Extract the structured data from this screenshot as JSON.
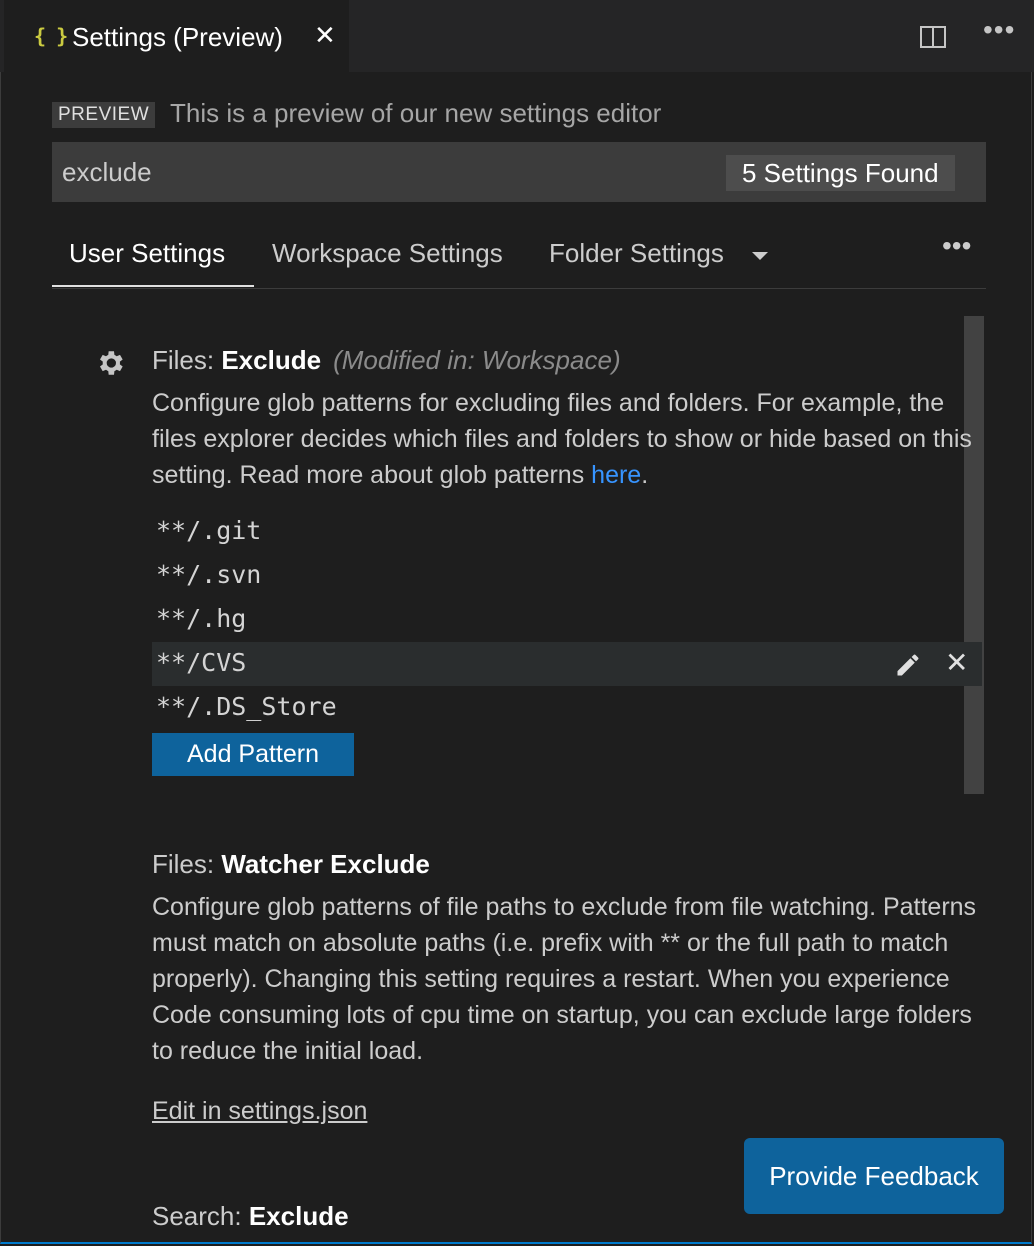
{
  "tab": {
    "icon": "{ }",
    "title": "Settings (Preview)",
    "close": "✕",
    "more": "•••"
  },
  "preview": {
    "badge": "PREVIEW",
    "text": "This is a preview of our new settings editor"
  },
  "search": {
    "value": "exclude",
    "count": "5 Settings Found"
  },
  "scopes": {
    "items": [
      "User Settings",
      "Workspace Settings",
      "Folder Settings"
    ],
    "active": "User Settings",
    "more": "•••"
  },
  "settings": [
    {
      "category": "Files: ",
      "name": "Exclude",
      "modified": "(Modified in: Workspace)",
      "description": "Configure glob patterns for excluding files and folders. For example, the files explorer decides which files and folders to show or hide based on this setting. Read more about glob patterns ",
      "link_text": "here",
      "link_suffix": ".",
      "patterns": [
        "**/.git",
        "**/.svn",
        "**/.hg",
        "**/CVS",
        "**/.DS_Store"
      ],
      "add_label": "Add Pattern",
      "remove_glyph": "✕"
    },
    {
      "category": "Files: ",
      "name": "Watcher Exclude",
      "description": "Configure glob patterns of file paths to exclude from file watching. Patterns must match on absolute paths (i.e. prefix with ** or the full path to match properly). Changing this setting requires a restart. When you experience Code consuming lots of cpu time on startup, you can exclude large folders to reduce the initial load.",
      "edit_link": "Edit in settings.json"
    },
    {
      "category": "Search: ",
      "name": "Exclude"
    }
  ],
  "feedback": {
    "label": "Provide Feedback"
  },
  "colors": {
    "background": "#1e1e1e",
    "button": "#0e639c",
    "link": "#3794ff",
    "json_icon": "#cbcb41"
  }
}
